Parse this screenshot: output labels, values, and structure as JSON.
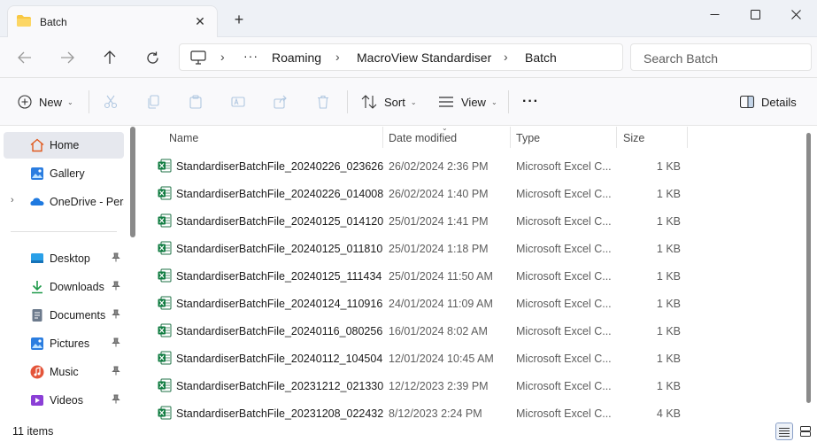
{
  "window": {
    "tab_title": "Batch",
    "new_tab_symbol": "+",
    "close_symbol": "✕"
  },
  "address": {
    "ellipsis": "···",
    "crumbs": [
      "Roaming",
      "MacroView Standardiser",
      "Batch"
    ],
    "separator": "›",
    "search_placeholder": "Search Batch"
  },
  "toolbar": {
    "new_label": "New",
    "sort_label": "Sort",
    "view_label": "View",
    "more_label": "···",
    "details_label": "Details",
    "chevron": "⌄"
  },
  "sidebar": {
    "items": [
      {
        "label": "Home",
        "icon": "home-icon",
        "selected": true
      },
      {
        "label": "Gallery",
        "icon": "gallery-icon"
      },
      {
        "label": "OneDrive - Perso",
        "icon": "onedrive-icon",
        "expander": "›"
      },
      {
        "label": "Desktop",
        "icon": "desktop-icon",
        "pin": "📌"
      },
      {
        "label": "Downloads",
        "icon": "downloads-icon",
        "pin": "📌"
      },
      {
        "label": "Documents",
        "icon": "documents-icon",
        "pin": "📌"
      },
      {
        "label": "Pictures",
        "icon": "pictures-icon",
        "pin": "📌"
      },
      {
        "label": "Music",
        "icon": "music-icon",
        "pin": "📌"
      },
      {
        "label": "Videos",
        "icon": "videos-icon",
        "pin": "📌"
      }
    ]
  },
  "columns": {
    "name": "Name",
    "date": "Date modified",
    "type": "Type",
    "size": "Size"
  },
  "files": [
    {
      "name": "StandardiserBatchFile_20240226_023626",
      "date": "26/02/2024 2:36 PM",
      "type": "Microsoft Excel C...",
      "size": "1 KB"
    },
    {
      "name": "StandardiserBatchFile_20240226_014008",
      "date": "26/02/2024 1:40 PM",
      "type": "Microsoft Excel C...",
      "size": "1 KB"
    },
    {
      "name": "StandardiserBatchFile_20240125_014120",
      "date": "25/01/2024 1:41 PM",
      "type": "Microsoft Excel C...",
      "size": "1 KB"
    },
    {
      "name": "StandardiserBatchFile_20240125_011810",
      "date": "25/01/2024 1:18 PM",
      "type": "Microsoft Excel C...",
      "size": "1 KB"
    },
    {
      "name": "StandardiserBatchFile_20240125_111434",
      "date": "25/01/2024 11:50 AM",
      "type": "Microsoft Excel C...",
      "size": "1 KB"
    },
    {
      "name": "StandardiserBatchFile_20240124_110916",
      "date": "24/01/2024 11:09 AM",
      "type": "Microsoft Excel C...",
      "size": "1 KB"
    },
    {
      "name": "StandardiserBatchFile_20240116_080256",
      "date": "16/01/2024 8:02 AM",
      "type": "Microsoft Excel C...",
      "size": "1 KB"
    },
    {
      "name": "StandardiserBatchFile_20240112_104504",
      "date": "12/01/2024 10:45 AM",
      "type": "Microsoft Excel C...",
      "size": "1 KB"
    },
    {
      "name": "StandardiserBatchFile_20231212_021330",
      "date": "12/12/2023 2:39 PM",
      "type": "Microsoft Excel C...",
      "size": "1 KB"
    },
    {
      "name": "StandardiserBatchFile_20231208_022432",
      "date": "8/12/2023 2:24 PM",
      "type": "Microsoft Excel C...",
      "size": "4 KB"
    }
  ],
  "status": {
    "item_count": "11 items"
  },
  "colors": {
    "accent": "#0067c0",
    "excel_green": "#107c41",
    "folder_yellow": "#f8c843",
    "selected_bg": "#e6e8ee"
  }
}
